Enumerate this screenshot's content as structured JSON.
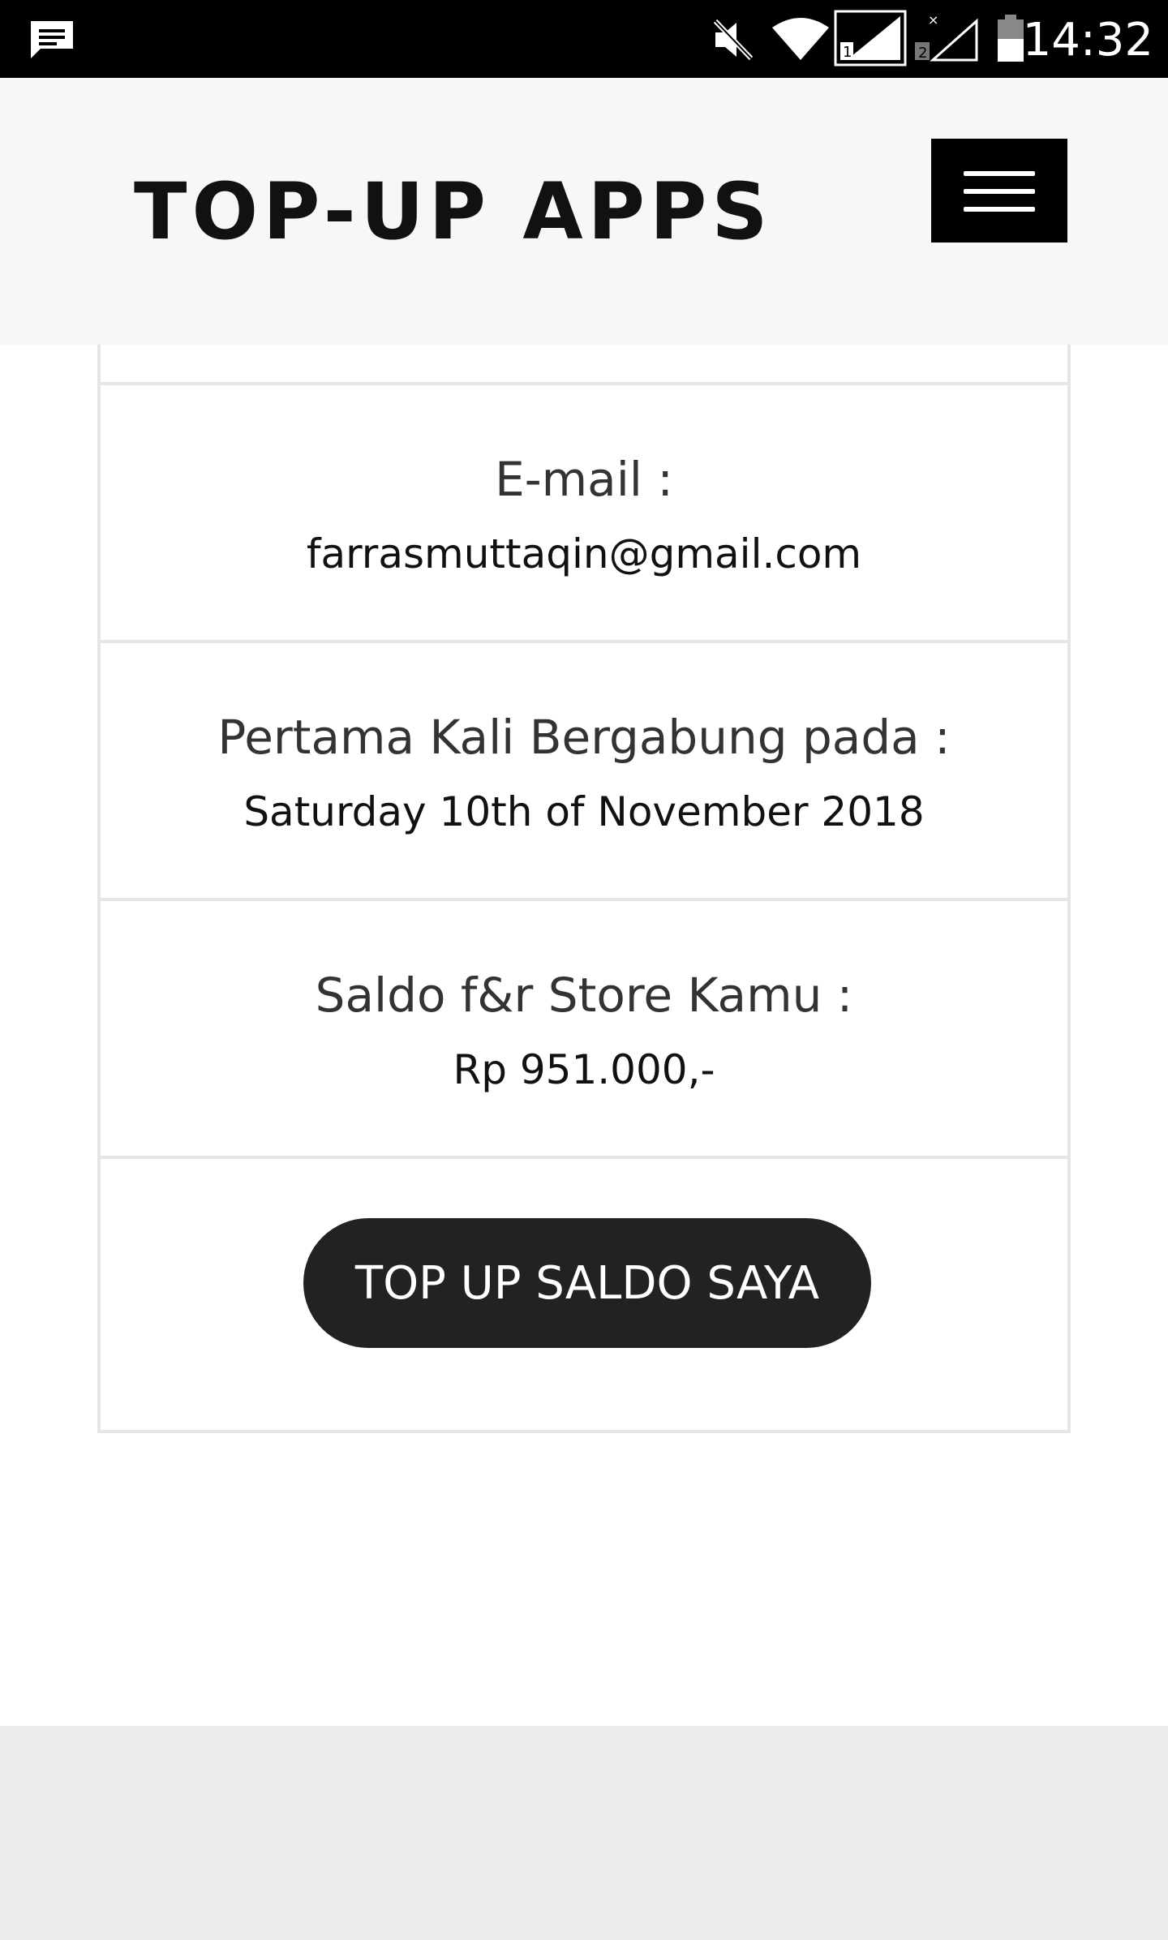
{
  "status_bar": {
    "time": "14:32",
    "icons": [
      "message-icon",
      "mute-icon",
      "wifi-icon",
      "signal-sim1-icon",
      "signal-sim2-icon",
      "battery-icon"
    ]
  },
  "header": {
    "title": "TOP-UP APPS",
    "menu_icon": "hamburger-menu-icon"
  },
  "profile": {
    "email_label": "E-mail :",
    "email_value": "farrasmuttaqin@gmail.com",
    "joined_label": "Pertama Kali Bergabung pada :",
    "joined_value": "Saturday 10th of November 2018",
    "balance_label": "Saldo f&r Store Kamu :",
    "balance_value": "Rp 951.000,-"
  },
  "actions": {
    "topup_label": "TOP UP SALDO SAYA"
  },
  "colors": {
    "header_bg": "#f7f7f7",
    "button_bg": "#222222",
    "border": "#e6e6e6",
    "footer_bg": "#ececec"
  }
}
